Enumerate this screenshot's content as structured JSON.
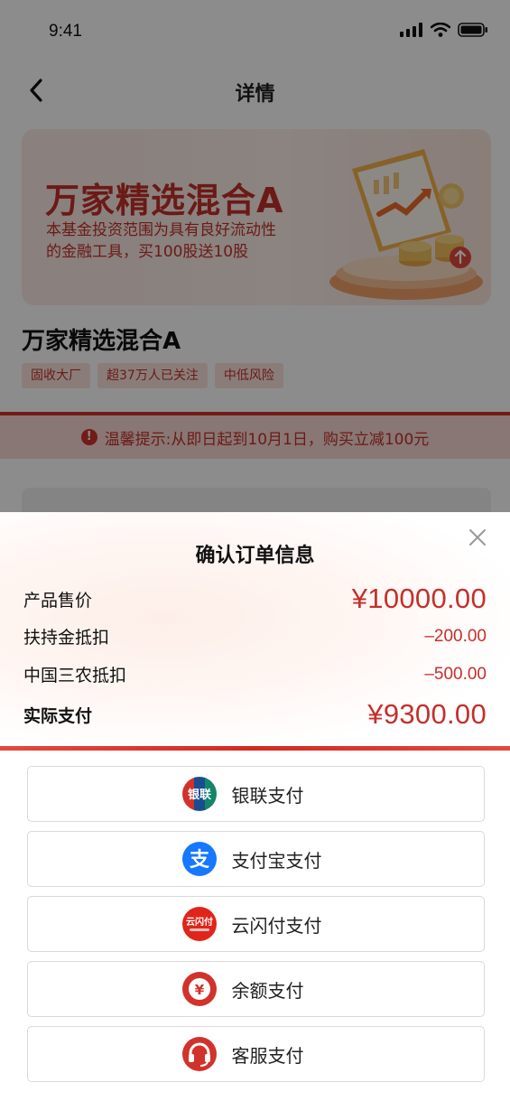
{
  "status": {
    "time": "9:41"
  },
  "nav": {
    "title": "详情"
  },
  "banner": {
    "title": "万家精选混合A",
    "desc": "本基金投资范围为具有良好流动性的金融工具，买100股送10股"
  },
  "product": {
    "name": "万家精选混合A",
    "tags": [
      "固收大厂",
      "超37万人已关注",
      "中低风险"
    ]
  },
  "tip": {
    "text": "温馨提示:从即日起到10月1日，购买立减100元"
  },
  "sheet": {
    "title": "确认订单信息",
    "rows": [
      {
        "label": "产品售价",
        "value": "¥10000.00"
      },
      {
        "label": "扶持金抵扣",
        "value": "–200.00"
      },
      {
        "label": "中国三农抵扣",
        "value": "–500.00"
      },
      {
        "label": "实际支付",
        "value": "¥9300.00"
      }
    ],
    "payments": [
      {
        "label": "银联支付",
        "icon": "unionpay-icon",
        "icon_text": "银联",
        "color": "#d1322b"
      },
      {
        "label": "支付宝支付",
        "icon": "alipay-icon",
        "icon_text": "支",
        "color": "#1677ff"
      },
      {
        "label": "云闪付支付",
        "icon": "quickpass-icon",
        "icon_text": "云闪付",
        "color": "#e0251b"
      },
      {
        "label": "余额支付",
        "icon": "balance-icon",
        "icon_text": "¥",
        "color": "#d1322b"
      },
      {
        "label": "客服支付",
        "icon": "headset-icon",
        "icon_text": "",
        "color": "#d1322b"
      }
    ]
  },
  "colors": {
    "accent": "#c4302b",
    "tip_bg": "#f7d9d3"
  }
}
